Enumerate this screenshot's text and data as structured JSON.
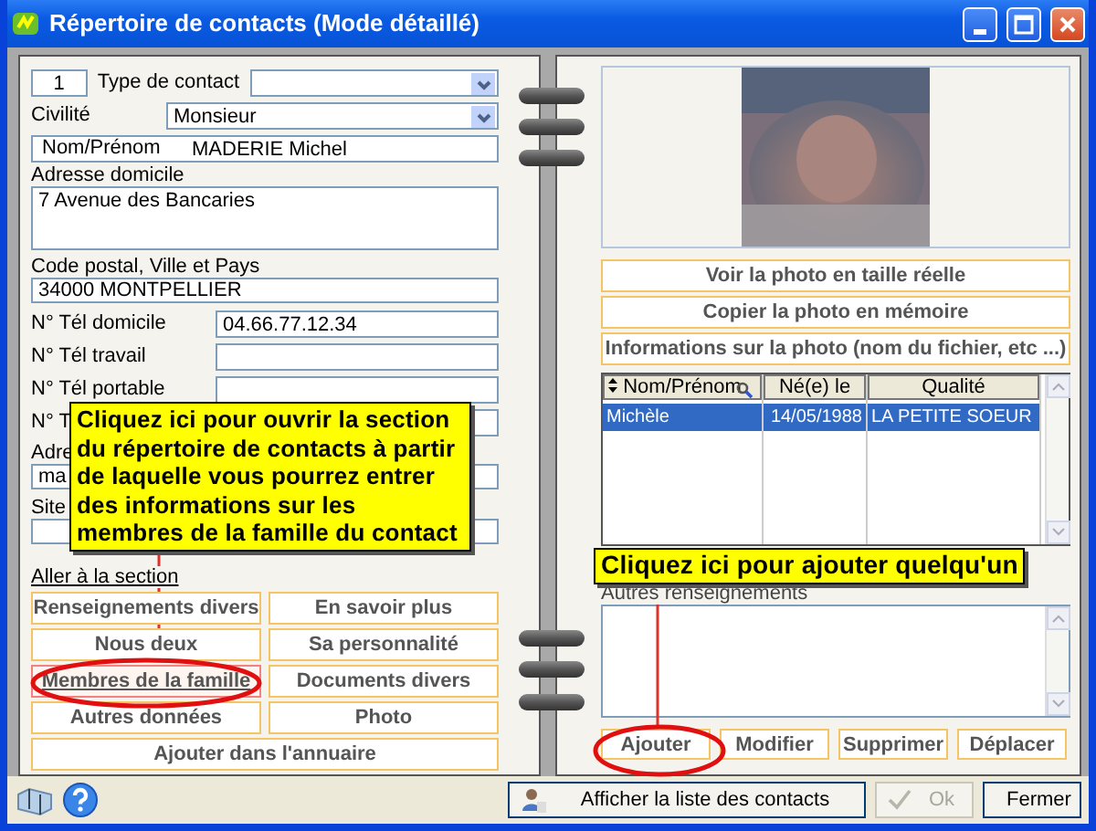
{
  "window": {
    "title": "Répertoire de contacts (Mode détaillé)"
  },
  "fields": [
    {
      "kind": "number-type",
      "number": "1",
      "label": "Type de contact"
    },
    {
      "kind": "side-select",
      "label": "Civilité",
      "value": "Monsieur"
    },
    {
      "kind": "inline",
      "label": "Nom/Prénom",
      "value": "MADERIE Michel"
    },
    {
      "kind": "area",
      "label": "Adresse domicile",
      "value": "7 Avenue des Bancaries"
    },
    {
      "kind": "stacked",
      "label": "Code postal, Ville et Pays",
      "value": "34000 MONTPELLIER"
    },
    {
      "kind": "side",
      "label": "N° Tél domicile",
      "value": "04.66.77.12.34"
    },
    {
      "kind": "side",
      "label": "N° Tél travail"
    },
    {
      "kind": "side",
      "label": "N° Tél portable"
    },
    {
      "kind": "side",
      "label": "N° T"
    },
    {
      "kind": "stacked",
      "label": "Adre",
      "value": "ma"
    },
    {
      "kind": "stacked",
      "label": "Site"
    }
  ],
  "section_link": "Aller à la section",
  "section_buttons": [
    {
      "label": "Renseignements divers",
      "focused": false
    },
    {
      "label": "En savoir plus",
      "focused": false
    },
    {
      "label": "Nous deux",
      "focused": false
    },
    {
      "label": "Sa personnalité",
      "focused": false
    },
    {
      "label": "Membres de la famille",
      "focused": true
    },
    {
      "label": "Documents divers",
      "focused": false
    },
    {
      "label": "Autres données",
      "focused": false
    },
    {
      "label": "Photo",
      "focused": false
    },
    {
      "label": "Ajouter dans l'annuaire",
      "focused": false
    }
  ],
  "photo": {
    "kind": "picture"
  },
  "photo_buttons": [
    "Voir la photo en taille réelle",
    "Copier la photo en mémoire",
    "Informations sur la photo (nom du fichier, etc ...)"
  ],
  "table": {
    "columns": [
      "Nom/Prénom",
      "Né(e) le",
      "Qualité"
    ],
    "rows": [
      {
        "cells": [
          "Michèle",
          "14/05/1988",
          "LA PETITE SOEUR"
        ],
        "selected": true
      }
    ]
  },
  "other_label": "Autres renseignements",
  "actions": [
    "Ajouter",
    "Modifier",
    "Supprimer",
    "Déplacer"
  ],
  "footer_buttons": [
    {
      "label": "Afficher la liste des contacts",
      "disabled": false
    },
    {
      "label": "Ok",
      "disabled": true
    },
    {
      "label": "Fermer",
      "disabled": false
    }
  ],
  "callouts": [
    {
      "text": "Cliquez ici pour ouvrir la section du répertoire de contacts à partir de laquelle vous pourrez entrer des informations sur les membres de la famille du contact"
    },
    {
      "text": "Cliquez ici pour ajouter quelqu'un"
    }
  ]
}
